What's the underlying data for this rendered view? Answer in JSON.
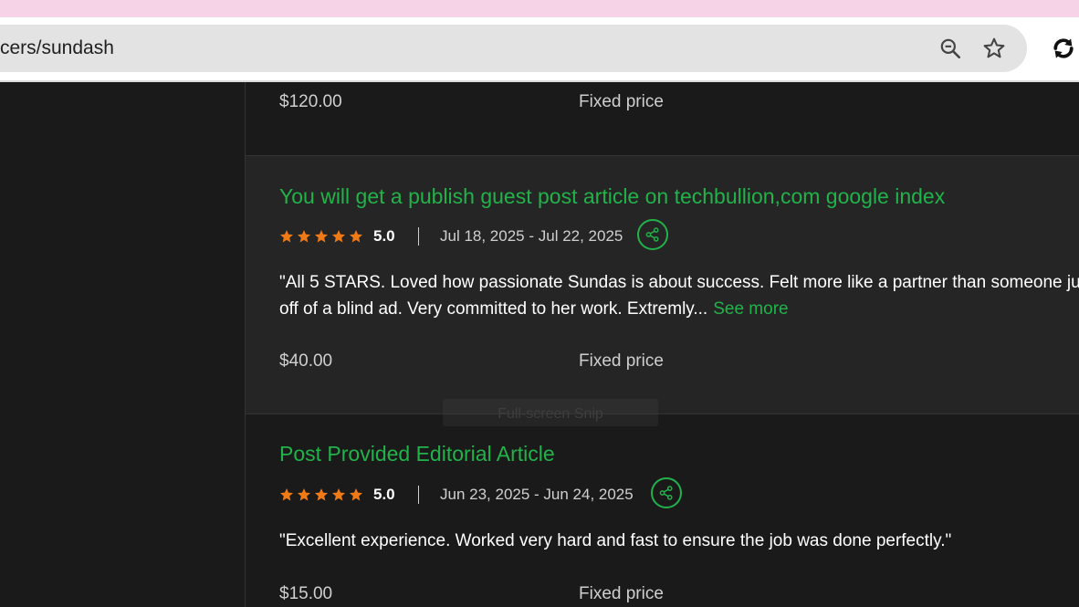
{
  "browser": {
    "url": "cers/sundash"
  },
  "reviews": [
    {
      "price": "$120.00",
      "price_type": "Fixed price"
    },
    {
      "title": "You will get a publish guest post article on techbullion,com google index",
      "rating": "5.0",
      "stars": 5,
      "dates": "Jul 18, 2025 - Jul 22, 2025",
      "text_line1": "\"All 5 STARS. Loved how passionate Sundas is about success. Felt more like a partner than someone ju",
      "text_line2": "off of a blind ad. Very committed to her work. Extremly...",
      "see_more": "See more",
      "price": "$40.00",
      "price_type": "Fixed price"
    },
    {
      "title": "Post Provided Editorial Article",
      "rating": "5.0",
      "stars": 5,
      "dates": "Jun 23, 2025 - Jun 24, 2025",
      "text_line1": "\"Excellent experience. Worked very hard and fast to ensure the job was done perfectly.\"",
      "price": "$15.00",
      "price_type": "Fixed price"
    }
  ],
  "overlay": {
    "snip_label": "Full-screen Snip"
  },
  "colors": {
    "accent_green": "#22b24a",
    "star_orange": "#f07b16",
    "background": "#1a1a1a",
    "card_highlight": "#252525"
  }
}
